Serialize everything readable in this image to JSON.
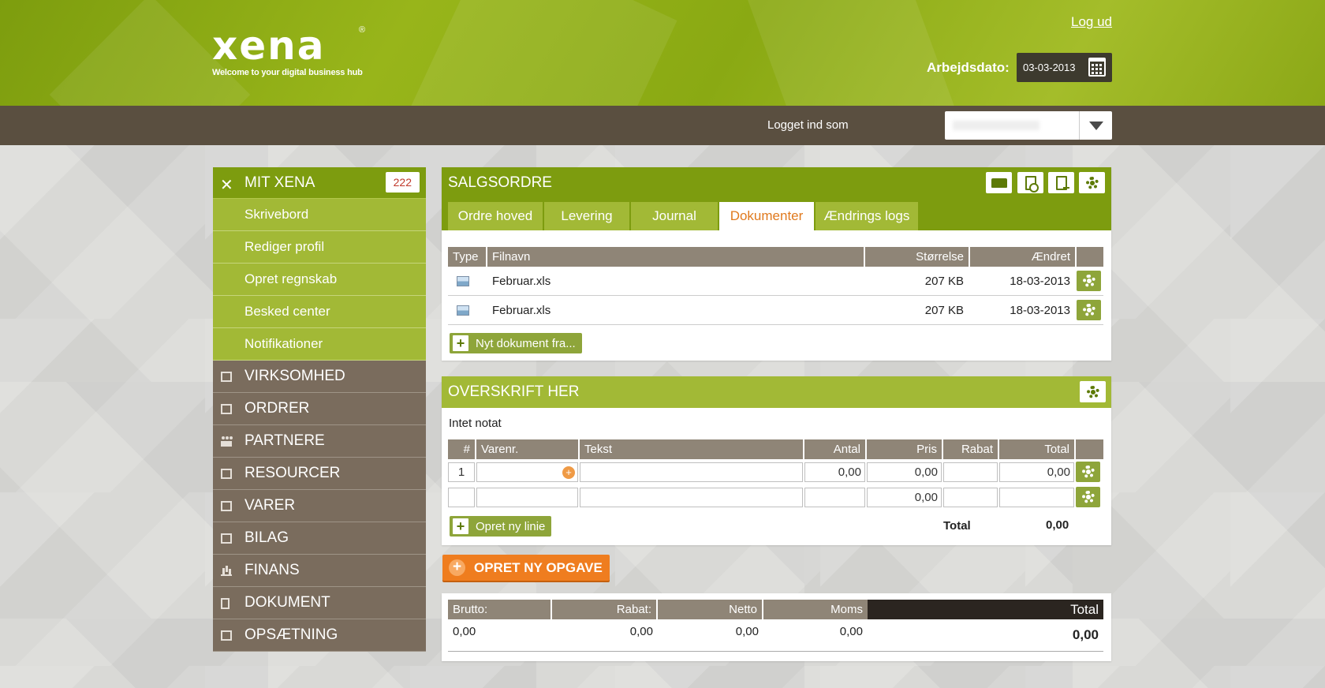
{
  "header": {
    "logo_text": "xena",
    "logo_reg": "®",
    "tagline": "Welcome to your digital business hub",
    "logout": "Log ud",
    "workdate_label": "Arbejdsdato:",
    "workdate_value": "03-03-2013"
  },
  "userbar": {
    "label": "Logget ind som"
  },
  "sidebar": {
    "top": {
      "label": "MIT XENA",
      "count": "222"
    },
    "sub_items": [
      {
        "label": "Skrivebord"
      },
      {
        "label": "Rediger profil"
      },
      {
        "label": "Opret regnskab"
      },
      {
        "label": "Besked center"
      },
      {
        "label": "Notifikationer"
      }
    ],
    "main_items": [
      {
        "label": "VIRKSOMHED",
        "icon": "building-icon"
      },
      {
        "label": "ORDRER",
        "icon": "list-icon"
      },
      {
        "label": "PARTNERE",
        "icon": "people-icon"
      },
      {
        "label": "RESOURCER",
        "icon": "resource-icon"
      },
      {
        "label": "VARER",
        "icon": "basket-icon"
      },
      {
        "label": "BILAG",
        "icon": "voucher-icon"
      },
      {
        "label": "FINANS",
        "icon": "bar-chart-icon"
      },
      {
        "label": "DOKUMENT",
        "icon": "document-icon"
      },
      {
        "label": "OPSÆTNING",
        "icon": "settings-grid-icon"
      }
    ]
  },
  "salgsordre": {
    "title": "SALGSORDRE",
    "tabs": [
      {
        "label": "Ordre hoved"
      },
      {
        "label": "Levering"
      },
      {
        "label": "Journal"
      },
      {
        "label": "Dokumenter"
      },
      {
        "label": "Ændrings logs"
      }
    ],
    "active_tab": "Dokumenter",
    "columns": {
      "type": "Type",
      "filename": "Filnavn",
      "size": "Størrelse",
      "changed": "Ændret"
    },
    "rows": [
      {
        "filename": "Februar.xls",
        "size": "207 KB",
        "changed": "18-03-2013"
      },
      {
        "filename": "Februar.xls",
        "size": "207 KB",
        "changed": "18-03-2013"
      }
    ],
    "new_doc_button": "Nyt dokument fra..."
  },
  "overskrift": {
    "title": "OVERSKRIFT HER",
    "note": "Intet notat",
    "columns": {
      "num": "#",
      "varenr": "Varenr.",
      "tekst": "Tekst",
      "antal": "Antal",
      "pris": "Pris",
      "rabat": "Rabat",
      "total": "Total"
    },
    "lines": [
      {
        "num": "1",
        "varenr": "",
        "tekst": "",
        "antal": "0,00",
        "pris": "0,00",
        "rabat": "",
        "total": "0,00"
      },
      {
        "num": "",
        "varenr": "",
        "tekst": "",
        "antal": "",
        "pris": "0,00",
        "rabat": "",
        "total": ""
      }
    ],
    "new_line_button": "Opret ny linie",
    "total_label": "Total",
    "total_value": "0,00"
  },
  "new_task_button": "OPRET NY OPGAVE",
  "summary": {
    "columns": {
      "brutto": "Brutto:",
      "rabat": "Rabat:",
      "netto": "Netto",
      "moms": "Moms",
      "total": "Total"
    },
    "values": {
      "brutto": "0,00",
      "rabat": "0,00",
      "netto": "0,00",
      "moms": "0,00",
      "total": "0,00"
    }
  },
  "colors": {
    "green": "#7d9c0f",
    "light_green": "#a2b936",
    "brown": "#7a6c5d",
    "orange": "#ef7d1f",
    "dark_bar": "#5a4f40"
  }
}
